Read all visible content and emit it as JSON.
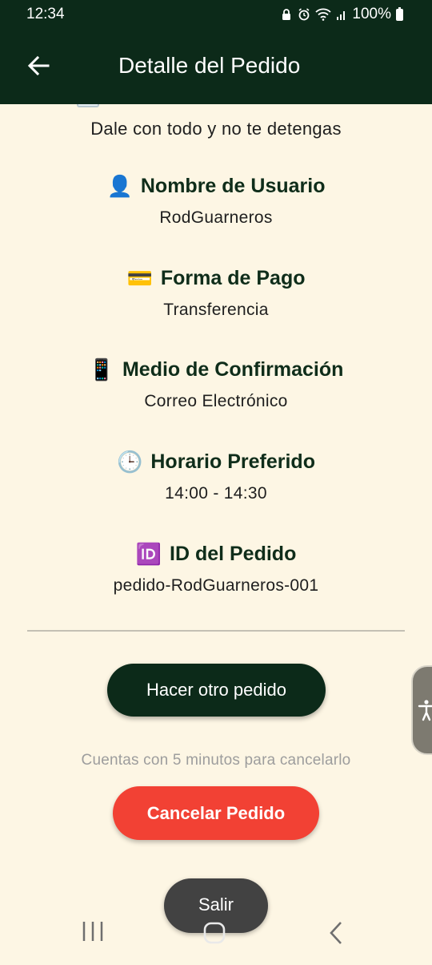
{
  "status_bar": {
    "time": "12:34",
    "battery": "100%",
    "icons": [
      "lock-icon",
      "alarm-icon",
      "wifi-icon",
      "signal-icon",
      "battery-icon"
    ]
  },
  "app_bar": {
    "title": "Detalle del Pedido",
    "back_icon": "arrow-left-icon"
  },
  "motto": "Dale con todo y no te detengas",
  "details": [
    {
      "emoji": "👤",
      "label": "Nombre de Usuario",
      "value": "RodGuarneros"
    },
    {
      "emoji": "💳",
      "label": "Forma de Pago",
      "value": "Transferencia"
    },
    {
      "emoji": "📱",
      "label": "Medio de Confirmación",
      "value": "Correo Electrónico"
    },
    {
      "emoji": "🕒",
      "label": "Horario Preferido",
      "value": "14:00 - 14:30"
    },
    {
      "emoji": "🆔",
      "label": "ID del Pedido",
      "value": "pedido-RodGuarneros-001"
    }
  ],
  "actions": {
    "another_order": "Hacer otro pedido",
    "cancel_note": "Cuentas con 5 minutos para cancelarlo",
    "cancel_order": "Cancelar Pedido",
    "exit": "Salir"
  },
  "colors": {
    "primary": "#0c2a19",
    "background": "#fdf6e4",
    "danger": "#f24134",
    "muted_text": "#9d9d9d"
  }
}
